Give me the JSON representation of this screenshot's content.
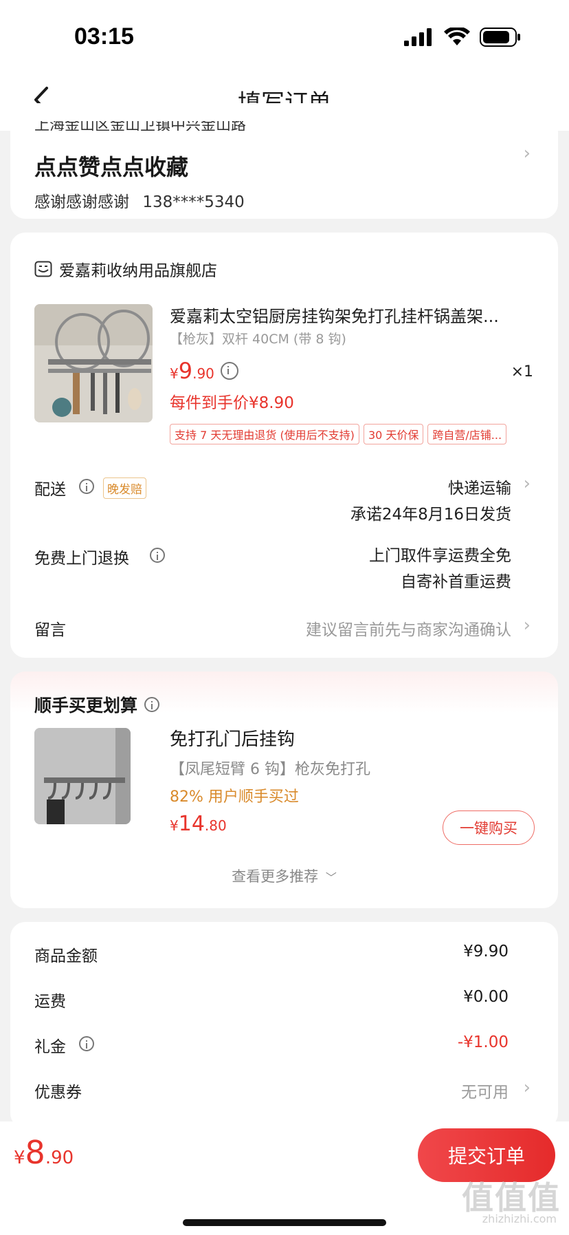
{
  "status": {
    "time": "03:15"
  },
  "nav": {
    "title": "填写订单"
  },
  "address": {
    "top_clipped": "上海金山区金山卫镇中兴金山路",
    "name": "点点赞点点收藏",
    "receiver": "感谢感谢感谢",
    "phone": "138****5340"
  },
  "store": {
    "name": "爱嘉莉收纳用品旗舰店"
  },
  "product": {
    "title": "爱嘉莉太空铝厨房挂钩架免打孔挂杆锅盖架...",
    "spec": "【枪灰】双杆 40CM (带 8 钩)",
    "price_symbol": "¥",
    "price_int": "9",
    "price_dec": ".90",
    "quantity": "×1",
    "unit_price": "每件到手价¥8.90",
    "tags": [
      "支持 7 天无理由退货 (使用后不支持)",
      "30 天价保",
      "跨自营/店铺..."
    ]
  },
  "delivery": {
    "label": "配送",
    "badge": "晚发赔",
    "method": "快递运输",
    "promise": "承诺24年8月16日发货"
  },
  "return_service": {
    "label": "免费上门退换",
    "line1": "上门取件享运费全免",
    "line2": "自寄补首重运费"
  },
  "message": {
    "label": "留言",
    "placeholder": "建议留言前先与商家沟通确认"
  },
  "upsell": {
    "title": "顺手买更划算",
    "item_title": "免打孔门后挂钩",
    "item_spec": "【凤尾短臂 6 钩】枪灰免打孔",
    "item_stat": "82% 用户顺手买过",
    "price_symbol": "¥",
    "price_int": "14",
    "price_dec": ".80",
    "buy_button": "一键购买",
    "more": "查看更多推荐"
  },
  "summary": {
    "goods_label": "商品金额",
    "goods_value": "¥9.90",
    "shipping_label": "运费",
    "shipping_value": "¥0.00",
    "gift_label": "礼金",
    "gift_value": "-¥1.00",
    "coupon_label": "优惠券",
    "coupon_value": "无可用"
  },
  "footer": {
    "total_symbol": "¥",
    "total_int": "8",
    "total_dec": ".90",
    "submit": "提交订单"
  },
  "watermark": {
    "main": "值值值",
    "sub": "zhizhizhi.com"
  },
  "colors": {
    "accent": "#e8342c",
    "orange": "#d98a2b",
    "background": "#f2f2f2"
  }
}
